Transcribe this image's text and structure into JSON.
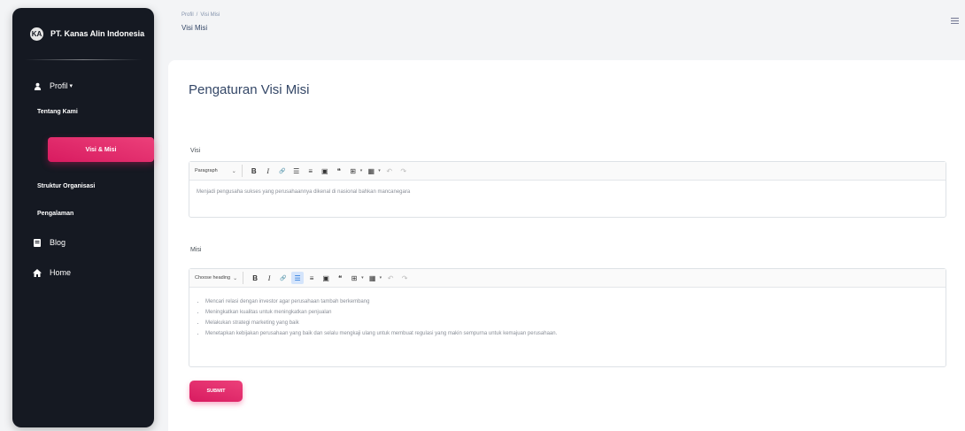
{
  "sidebar": {
    "brand": {
      "logo_text": "KA",
      "name": "PT. Kanas Alin Indonesia"
    },
    "items": [
      {
        "label": "Profil",
        "caret": "▾",
        "icon": "user-icon"
      },
      {
        "label": "Blog",
        "icon": "blog-icon"
      },
      {
        "label": "Home",
        "icon": "home-icon"
      }
    ],
    "subitems": [
      {
        "label": "Tentang Kami"
      },
      {
        "label": "Visi & Misi",
        "active": true
      },
      {
        "label": "Struktur Organisasi"
      },
      {
        "label": "Pengalaman"
      }
    ]
  },
  "header": {
    "breadcrumb": [
      "Profil",
      "Visi Misi"
    ],
    "separator": "/",
    "title": "Visi Misi",
    "right_icon": "menu-icon"
  },
  "card": {
    "title": "Pengaturan Visi Misi",
    "visi": {
      "label": "Visi",
      "heading_select": "Paragraph",
      "content": "Menjadi pengusaha sukses yang perusahaannya dikenal di nasional bahkan mancanegara"
    },
    "misi": {
      "label": "Misi",
      "heading_select": "Choose heading",
      "items": [
        "Mencari relasi dengan investor agar perusahaan tambah berkembang",
        "Meningkatkan kualitas untuk meningkatkan penjualan",
        "Melakukan strategi marketing yang baik",
        "Menetapkan kebijakan perusahaan yang baik dan selalu mengkaji ulang untuk membuat regulasi yang makin sempurna untuk kemajuan perusahaan."
      ]
    },
    "submit_label": "SUBMIT"
  },
  "toolbar": {
    "bold": "B",
    "italic": "I",
    "link": "🔗",
    "bulleted": "☰",
    "numbered": "≡",
    "image": "▣",
    "quote": "❝",
    "table": "⊞",
    "media": "▦",
    "undo": "↶",
    "redo": "↷"
  },
  "colors": {
    "sidebar_bg": "#151922",
    "accent": "#e91e63"
  }
}
